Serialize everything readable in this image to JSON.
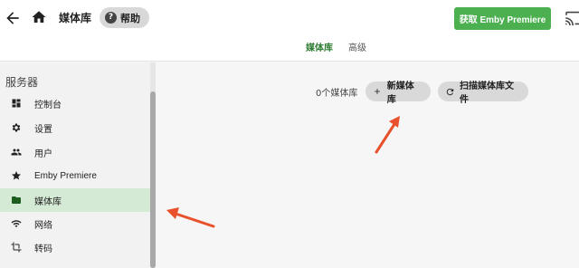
{
  "header": {
    "title": "媒体库",
    "help_label": "帮助",
    "premiere_label": "获取 Emby Premiere"
  },
  "tabs": [
    {
      "label": "媒体库",
      "active": true
    },
    {
      "label": "高级",
      "active": false
    }
  ],
  "sidebar": {
    "heading": "服务器",
    "items": [
      {
        "label": "控制台",
        "icon": "dashboard-icon"
      },
      {
        "label": "设置",
        "icon": "gear-icon"
      },
      {
        "label": "用户",
        "icon": "people-icon"
      },
      {
        "label": "Emby Premiere",
        "icon": "star-icon"
      },
      {
        "label": "媒体库",
        "icon": "folder-icon",
        "active": true
      },
      {
        "label": "网络",
        "icon": "wifi-icon"
      },
      {
        "label": "转码",
        "icon": "crop-icon"
      }
    ]
  },
  "main": {
    "library_count": "0个媒体库",
    "new_library_label": "新媒体库",
    "scan_label": "扫描媒体库文件"
  },
  "colors": {
    "accent": "#4caf50",
    "active_tab": "#2e7d32",
    "active_nav_bg": "#d5ead5",
    "annotation_arrow": "#e8512b"
  }
}
